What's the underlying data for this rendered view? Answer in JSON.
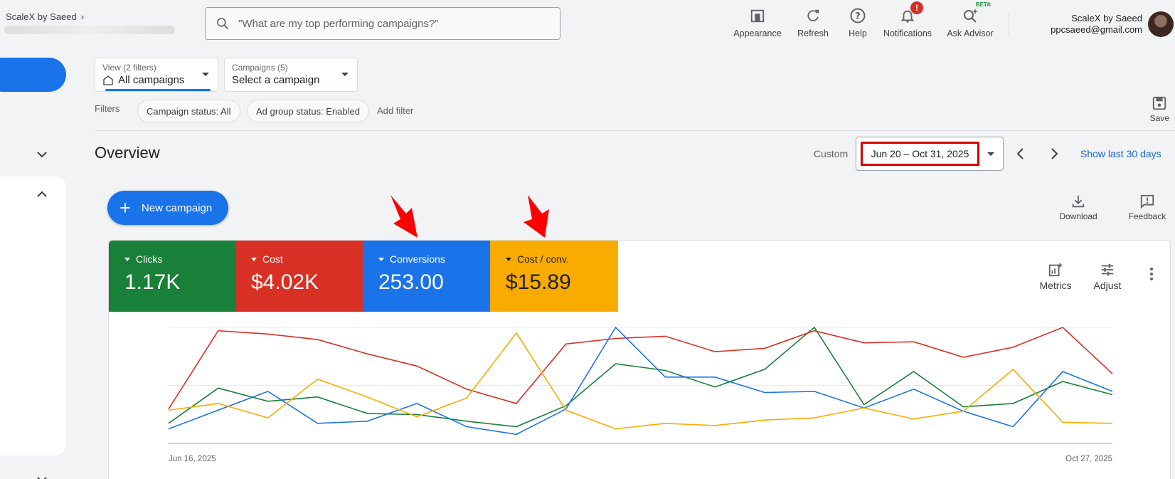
{
  "header": {
    "account_name": "ScaleX by Saeed",
    "search_placeholder": "\"What are my top performing campaigns?\"",
    "tools": [
      {
        "label": "Appearance",
        "icon": "appearance-icon"
      },
      {
        "label": "Refresh",
        "icon": "refresh-icon"
      },
      {
        "label": "Help",
        "icon": "help-icon"
      },
      {
        "label": "Notifications",
        "icon": "bell-icon",
        "badge": "!"
      },
      {
        "label": "Ask Advisor",
        "icon": "advisor-icon",
        "tag": "BETA"
      }
    ],
    "user_name": "ScaleX by Saeed",
    "user_email": "ppcsaeed@gmail.com"
  },
  "view_selector": {
    "small": "View (2 filters)",
    "value": "All campaigns"
  },
  "campaign_selector": {
    "small": "Campaigns (5)",
    "value": "Select a campaign"
  },
  "filters": {
    "label": "Filters",
    "chips": [
      "Campaign status: All",
      "Ad group status: Enabled"
    ],
    "add": "Add filter",
    "save": "Save"
  },
  "overview": {
    "title": "Overview",
    "custom": "Custom",
    "date_range": "Jun 20 – Oct 31, 2025",
    "show_last": "Show last 30 days",
    "new_campaign": "New campaign",
    "download": "Download",
    "feedback": "Feedback"
  },
  "metrics": [
    {
      "name": "Clicks",
      "value": "1.17K",
      "color": "#188038"
    },
    {
      "name": "Cost",
      "value": "$4.02K",
      "color": "#d93025"
    },
    {
      "name": "Conversions",
      "value": "253.00",
      "color": "#1a73e8"
    },
    {
      "name": "Cost / conv.",
      "value": "$15.89",
      "color": "#f9ab00"
    }
  ],
  "card_tools": {
    "metrics": "Metrics",
    "adjust": "Adjust"
  },
  "chart_data": {
    "type": "line",
    "x_start_label": "Jun 16, 2025",
    "x_end_label": "Oct 27, 2025",
    "series": [
      {
        "name": "Clicks",
        "color": "#188038",
        "values": [
          0.13,
          0.45,
          0.33,
          0.37,
          0.22,
          0.21,
          0.15,
          0.1,
          0.29,
          0.67,
          0.61,
          0.46,
          0.62,
          1.0,
          0.3,
          0.6,
          0.28,
          0.31,
          0.51,
          0.39
        ]
      },
      {
        "name": "Cost",
        "color": "#d93025",
        "values": [
          0.26,
          0.97,
          0.94,
          0.89,
          0.76,
          0.65,
          0.44,
          0.31,
          0.85,
          0.9,
          0.92,
          0.78,
          0.81,
          0.97,
          0.86,
          0.87,
          0.73,
          0.82,
          1.0,
          0.58
        ]
      },
      {
        "name": "Conversions",
        "color": "#1a73e8",
        "values": [
          0.08,
          0.25,
          0.42,
          0.13,
          0.15,
          0.31,
          0.1,
          0.03,
          0.26,
          1.0,
          0.55,
          0.55,
          0.41,
          0.42,
          0.27,
          0.44,
          0.24,
          0.1,
          0.6,
          0.42
        ]
      },
      {
        "name": "Cost / conv.",
        "color": "#f9ab00",
        "values": [
          0.25,
          0.31,
          0.18,
          0.53,
          0.37,
          0.19,
          0.36,
          0.95,
          0.25,
          0.08,
          0.13,
          0.11,
          0.16,
          0.18,
          0.27,
          0.17,
          0.24,
          0.62,
          0.14,
          0.13
        ]
      }
    ]
  }
}
